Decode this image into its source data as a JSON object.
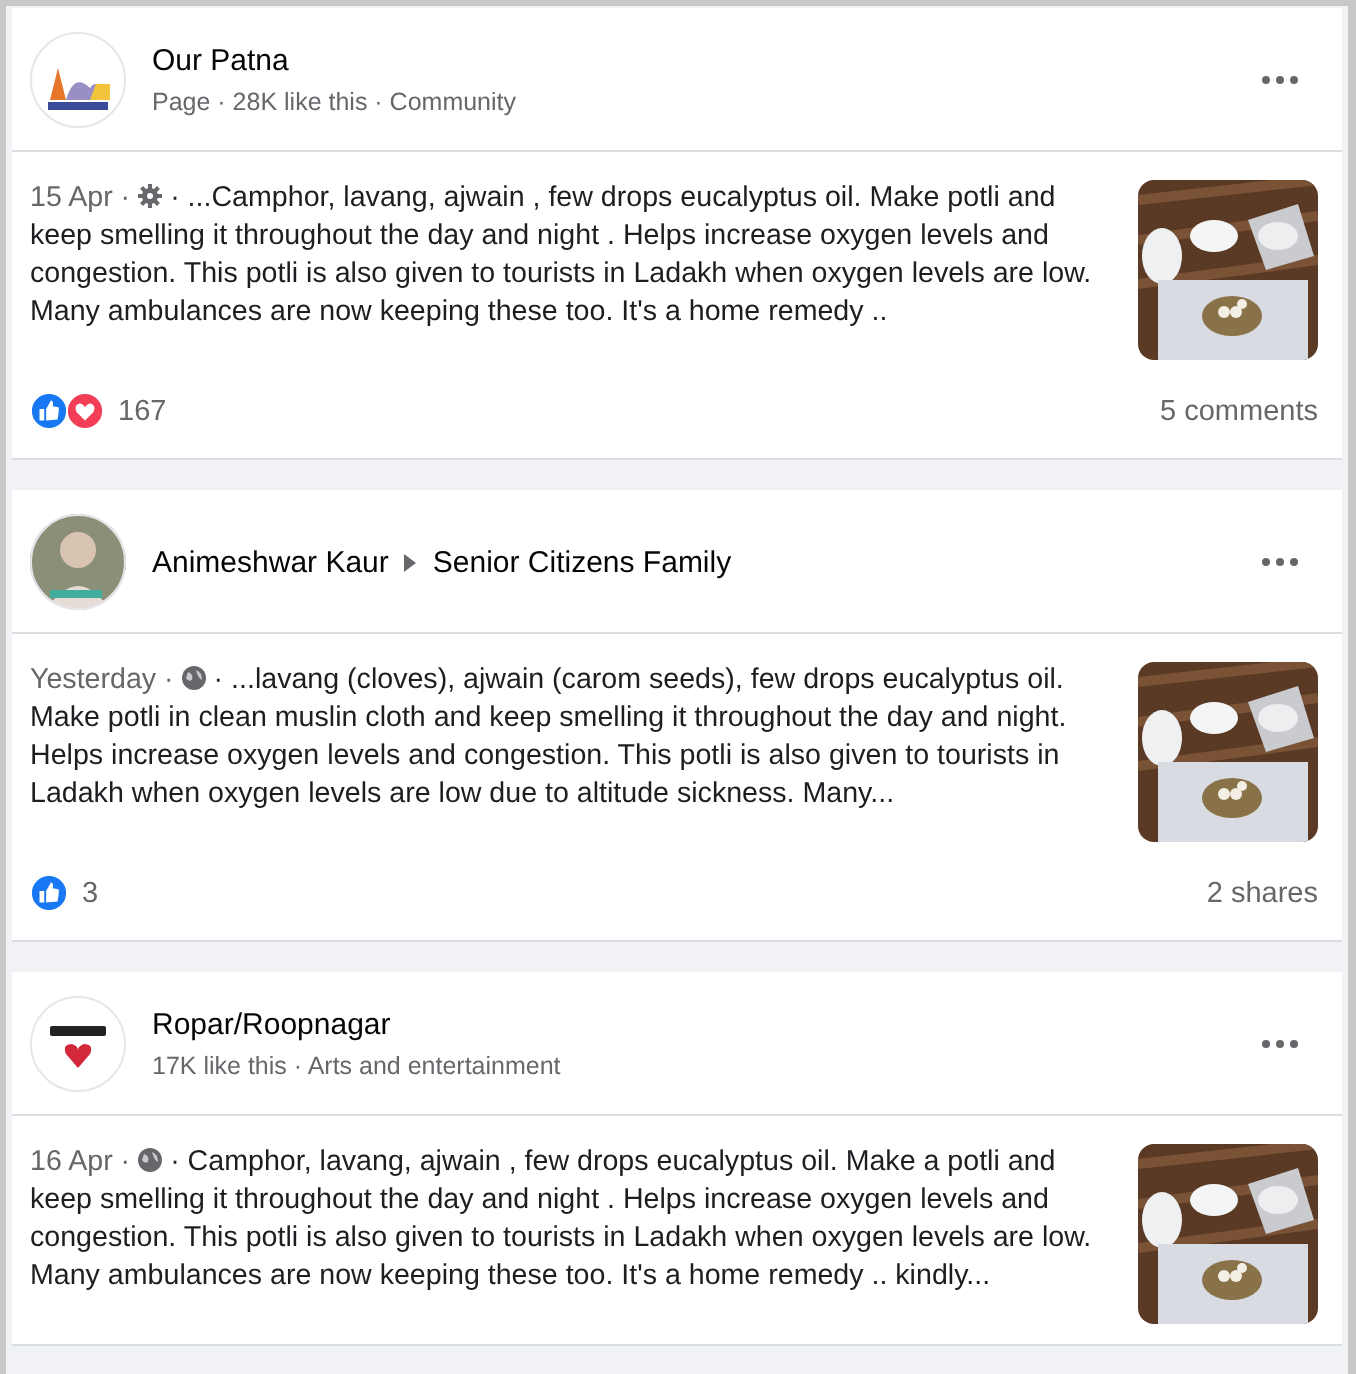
{
  "posts": [
    {
      "author": "Our Patna",
      "subtitle": "Page · 28K like this · Community",
      "time": "15 Apr ·",
      "audience": {
        "kind": "custom"
      },
      "text": "· ...Camphor, lavang, ajwain , few drops eucalyptus oil. Make potli and keep smelling it throughout the day and night . Helps increase oxygen levels and congestion. This potli is also given to tourists in Ladakh when oxygen levels are low. Many ambulances are now keeping these too. It's a home remedy ..",
      "reactions": [
        {
          "kind": "like"
        },
        {
          "kind": "love"
        }
      ],
      "reaction_count": "167",
      "footer_right": "5 comments"
    },
    {
      "author": "Animeshwar Kaur",
      "group": "Senior Citizens Family",
      "time": "Yesterday ·",
      "audience": {
        "kind": "public"
      },
      "text": "· ...lavang (cloves), ajwain (carom seeds), few drops eucalyptus oil. Make potli in clean muslin cloth and keep smelling it throughout the day and night. Helps increase oxygen levels and congestion. This potli is also given to tourists in Ladakh when oxygen levels are low due to altitude sickness. Many...",
      "reactions": [
        {
          "kind": "like"
        }
      ],
      "reaction_count": "3",
      "footer_right": "2 shares"
    },
    {
      "author": "Ropar/Roopnagar",
      "subtitle": "17K like this · Arts and entertainment",
      "time": "16 Apr ·",
      "audience": {
        "kind": "public"
      },
      "text": "· Camphor, lavang, ajwain , few drops eucalyptus oil. Make a potli and keep smelling it throughout the day and night . Helps increase oxygen levels and congestion. This potli is also given to tourists in Ladakh when oxygen levels are low. Many ambulances are now keeping these too. It's a home remedy .. kindly..."
    }
  ]
}
